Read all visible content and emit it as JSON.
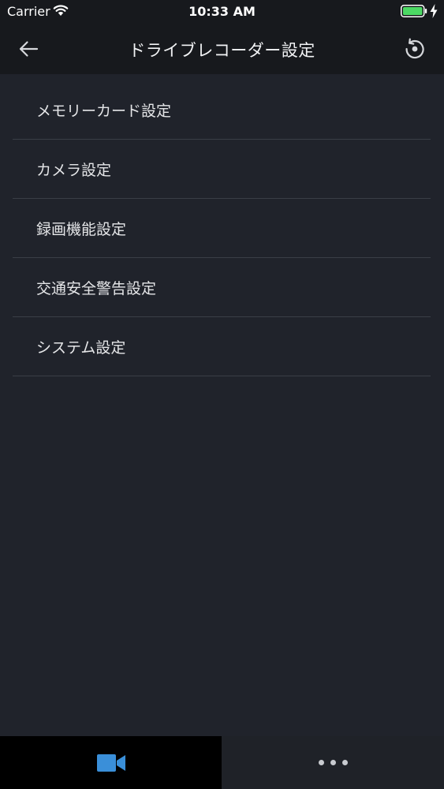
{
  "status_bar": {
    "carrier": "Carrier",
    "time": "10:33 AM",
    "battery_color": "#4cd964"
  },
  "nav": {
    "title": "ドライブレコーダー設定",
    "back_icon": "arrow-left-icon",
    "refresh_icon": "refresh-icon"
  },
  "menu": {
    "items": [
      {
        "label": "メモリーカード設定"
      },
      {
        "label": "カメラ設定"
      },
      {
        "label": "録画機能設定"
      },
      {
        "label": "交通安全警告設定"
      },
      {
        "label": "システム設定"
      }
    ]
  },
  "tabs": {
    "camera_icon": "video-camera-icon",
    "camera_color": "#3a8fd9",
    "more_icon": "more-dots-icon"
  }
}
